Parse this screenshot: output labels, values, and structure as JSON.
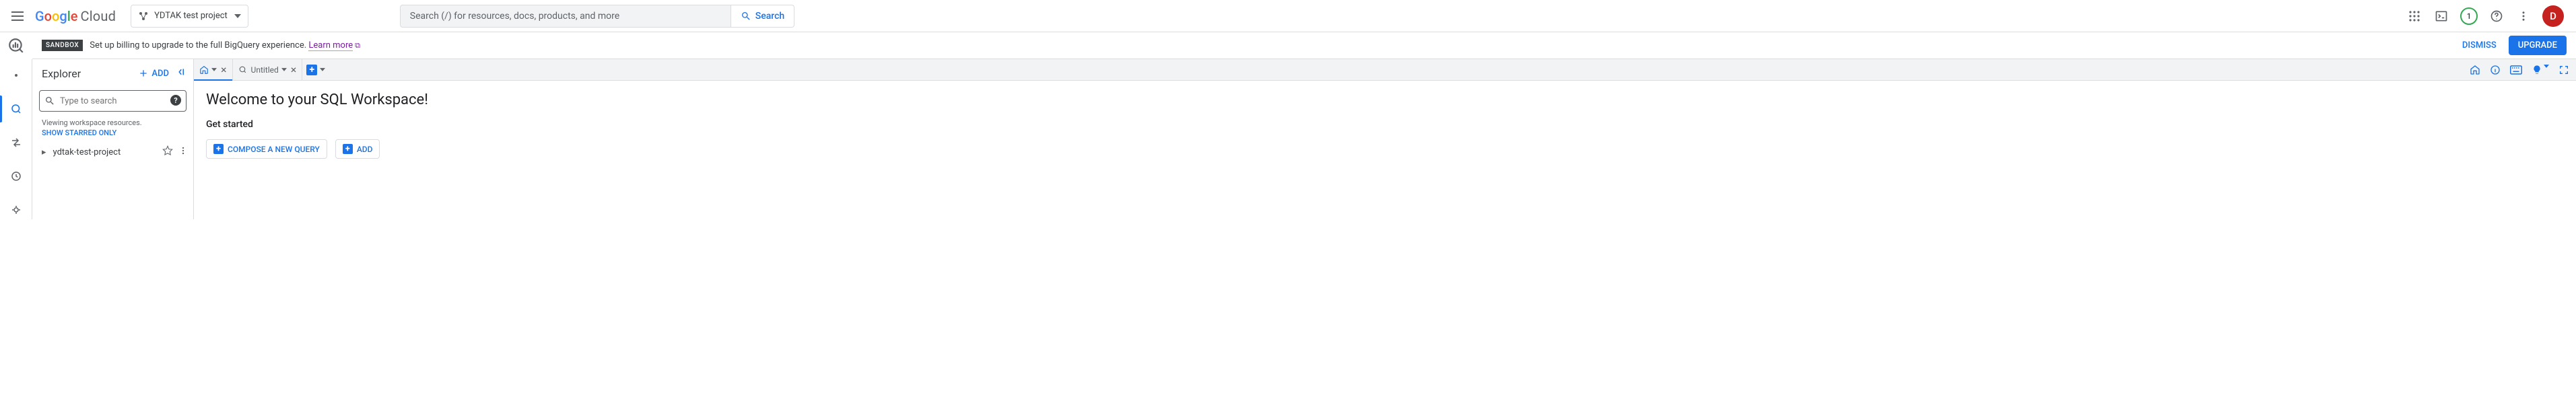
{
  "header": {
    "brand_cloud": "Cloud",
    "project_name": "YDTAK test project",
    "search_placeholder": "Search (/) for resources, docs, products, and more",
    "search_button": "Search",
    "notif_count": "1",
    "avatar_initial": "D"
  },
  "banner": {
    "badge": "SANDBOX",
    "text": "Set up billing to upgrade to the full BigQuery experience. ",
    "link": "Learn more",
    "dismiss": "DISMISS",
    "upgrade": "UPGRADE"
  },
  "explorer": {
    "title": "Explorer",
    "add": "ADD",
    "search_placeholder": "Type to search",
    "viewing": "Viewing workspace resources.",
    "show_starred": "SHOW STARRED ONLY",
    "project_node": "ydtak-test-project"
  },
  "tabs": {
    "untitled": "Untitled"
  },
  "content": {
    "welcome": "Welcome to your SQL Workspace!",
    "get_started": "Get started",
    "compose": "COMPOSE A NEW QUERY",
    "add": "ADD"
  }
}
